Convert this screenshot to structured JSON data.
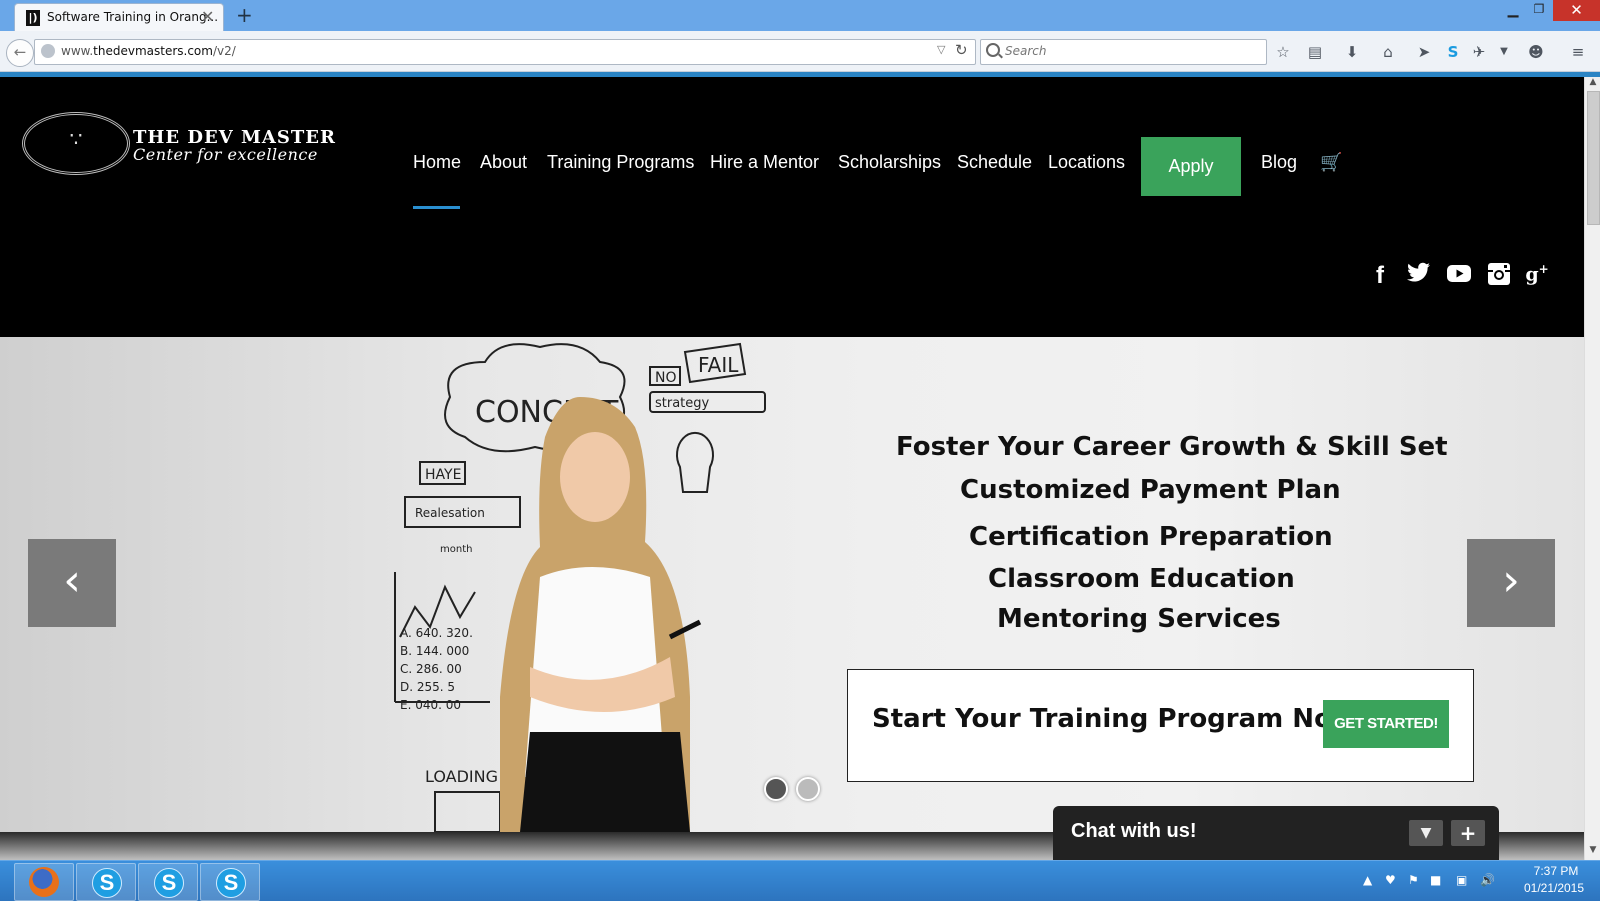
{
  "browser": {
    "tab_title": "Software Training in Orang...",
    "url_prefix": "www.",
    "url_domain": "thedevmasters.com",
    "url_path": "/v2/",
    "search_placeholder": "Search"
  },
  "site": {
    "logo_title": "THE DEV MASTER",
    "logo_subtitle": "Center for excellence",
    "nav": [
      "Home",
      "About",
      "Training Programs",
      "Hire a Mentor",
      "Scholarships",
      "Schedule",
      "Locations",
      "Apply",
      "Blog"
    ],
    "active_nav": "Home",
    "social": [
      "facebook",
      "twitter",
      "youtube",
      "instagram",
      "google-plus"
    ]
  },
  "hero": {
    "lines": [
      "Foster Your Career Growth & Skill Set",
      "Customized Payment Plan",
      "Certification Preparation",
      "Classroom Education",
      "Mentoring Services"
    ],
    "cta_text": "Start Your Training Program Now",
    "cta_button": "GET STARTED!",
    "slide_count": 2,
    "active_slide": 1
  },
  "chat": {
    "title": "Chat with us!"
  },
  "taskbar": {
    "time": "7:37 PM",
    "date": "01/21/2015",
    "apps": [
      "firefox",
      "skype",
      "skype",
      "skype"
    ]
  },
  "colors": {
    "accent_green": "#3aa35b",
    "nav_underline": "#2a8fd0",
    "header_bg": "#000000"
  }
}
